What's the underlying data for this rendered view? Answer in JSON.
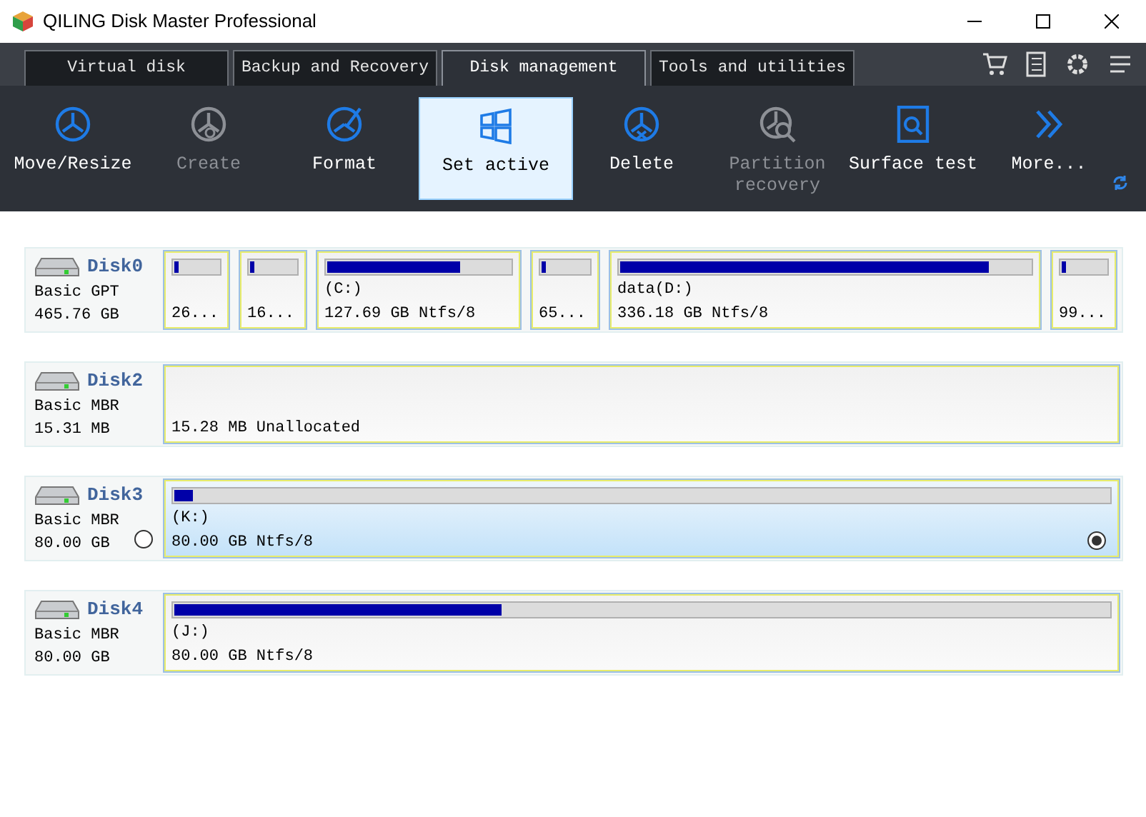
{
  "window": {
    "title": "QILING Disk Master Professional"
  },
  "tabs": [
    {
      "label": "Virtual disk",
      "selected": false
    },
    {
      "label": "Backup and Recovery",
      "selected": false
    },
    {
      "label": "Disk management",
      "selected": true
    },
    {
      "label": "Tools and utilities",
      "selected": false
    }
  ],
  "toolbar": [
    {
      "kind": "move",
      "label": "Move/Resize",
      "disabled": false,
      "selected": false
    },
    {
      "kind": "create",
      "label": "Create",
      "disabled": true,
      "selected": false
    },
    {
      "kind": "format",
      "label": "Format",
      "disabled": false,
      "selected": false
    },
    {
      "kind": "active",
      "label": "Set active",
      "disabled": false,
      "selected": true
    },
    {
      "kind": "delete",
      "label": "Delete",
      "disabled": false,
      "selected": false
    },
    {
      "kind": "recovery",
      "label": "Partition recovery",
      "disabled": true,
      "selected": false
    },
    {
      "kind": "surface",
      "label": "Surface test",
      "disabled": false,
      "selected": false
    },
    {
      "kind": "more",
      "label": "More...",
      "disabled": false,
      "selected": false
    }
  ],
  "disks": [
    {
      "name": "Disk0",
      "type": "Basic GPT",
      "size": "465.76 GB",
      "partitions": [
        {
          "kind": "partition",
          "level": 0.1,
          "size": "26...",
          "selected": false
        },
        {
          "kind": "partition",
          "level": 0.1,
          "size": "16...",
          "selected": false
        },
        {
          "kind": "partition",
          "level": 0.73,
          "label": "(C:)",
          "size": "127.69 GB Ntfs/8",
          "selected": false
        },
        {
          "kind": "partition",
          "level": 0.1,
          "size": "65...",
          "selected": false
        },
        {
          "kind": "partition",
          "level": 0.9,
          "label": "data(D:)",
          "size": "336.18 GB Ntfs/8",
          "selected": false
        },
        {
          "kind": "partition",
          "level": 0.1,
          "size": "99...",
          "selected": false
        }
      ]
    },
    {
      "name": "Disk2",
      "type": "Basic MBR",
      "size": "15.31 MB",
      "partitions": [
        {
          "kind": "unallocated",
          "size": "15.28 MB Unallocated",
          "selected": false
        }
      ]
    },
    {
      "name": "Disk3",
      "type": "Basic MBR",
      "size": "80.00 GB",
      "radio_checked": false,
      "partitions": [
        {
          "kind": "partition",
          "level": 0.02,
          "label": "(K:)",
          "size": "80.00 GB Ntfs/8",
          "selected": true
        }
      ]
    },
    {
      "name": "Disk4",
      "type": "Basic MBR",
      "size": "80.00 GB",
      "partitions": [
        {
          "kind": "partition",
          "level": 0.35,
          "label": "(J:)",
          "size": "80.00 GB Ntfs/8",
          "selected": false
        }
      ]
    }
  ]
}
